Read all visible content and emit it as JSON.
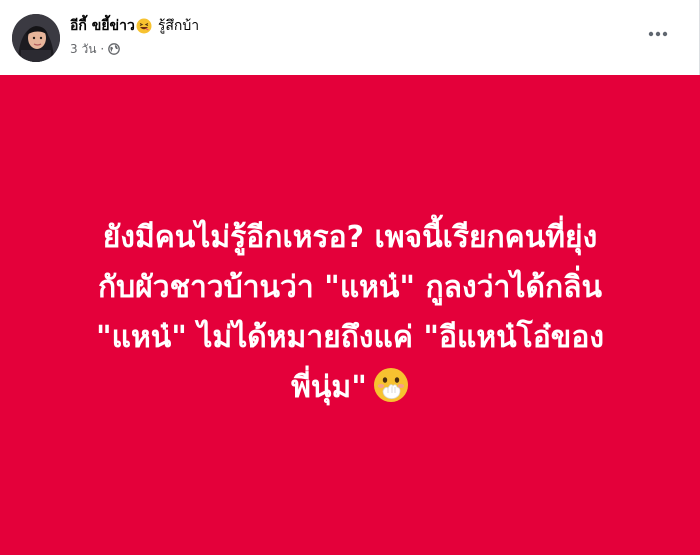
{
  "post": {
    "author": {
      "name": "อีกี้ ขยี้ข่าว",
      "name_emoji": "grinning-squinting-face-icon"
    },
    "feeling": "รู้สึกบ้า",
    "time": "3 วัน",
    "separator": "·",
    "privacy": "globe-icon",
    "more_icon": "more-horizontal-icon",
    "background_color": "#e4003a",
    "text_color": "#ffffff",
    "text_lines": [
      "ยังมีคนไม่รู้อีกเหรอ? เพจนี้เรียกคนที่ยุ่ง",
      "กับผัวชาวบ้านว่า \"แหน๋\" กูลงว่าได้กลิ่น",
      "\"แหน๋\" ไม่ได้หมายถึงแค่ \"อีแหน๋โอ๋ของ",
      "พี่นุ่ม\""
    ],
    "trailing_emoji": "face-with-hand-over-mouth-icon"
  }
}
